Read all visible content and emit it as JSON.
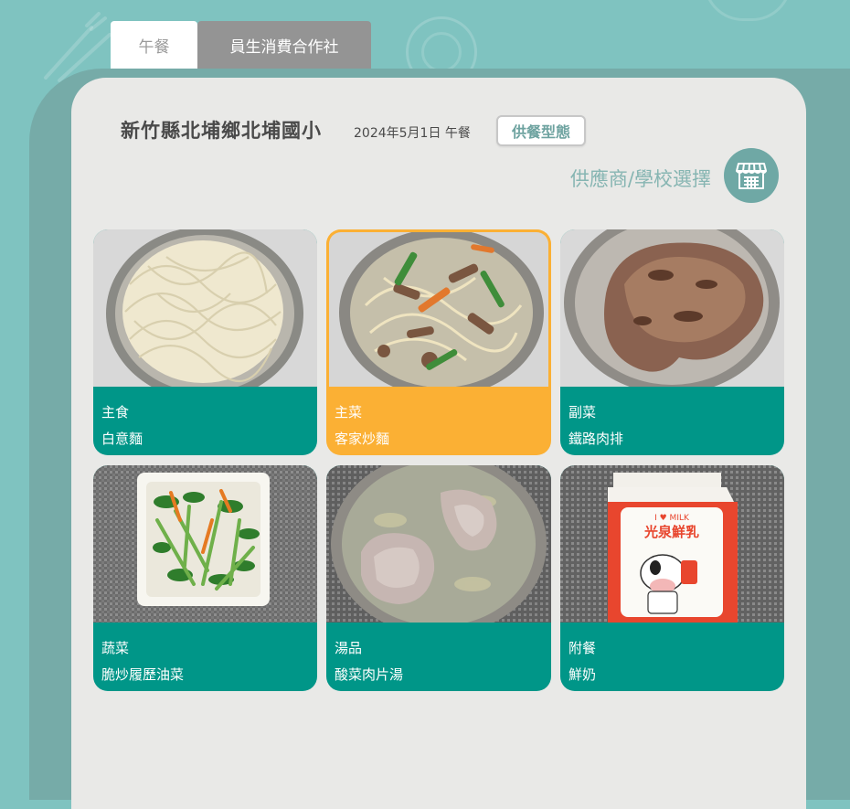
{
  "tabs": [
    {
      "label": "午餐",
      "active": true
    },
    {
      "label": "員生消費合作社",
      "active": false
    }
  ],
  "header": {
    "school_name": "新竹縣北埔鄉北埔國小",
    "meal_date": "2024年5月1日 午餐",
    "service_type_button": "供餐型態",
    "supplier_label": "供應商/學校選擇",
    "supplier_icon": "store-icon"
  },
  "colors": {
    "background": "#7fc3c0",
    "card": "#e9e9e7",
    "dish_caption": "#009688",
    "dish_highlight": "#fbb034",
    "accent_text": "#86b5b2"
  },
  "dishes": [
    {
      "category": "主食",
      "name": "白意麵",
      "highlight": false
    },
    {
      "category": "主菜",
      "name": "客家炒麵",
      "highlight": true
    },
    {
      "category": "副菜",
      "name": "鐵路肉排",
      "highlight": false
    },
    {
      "category": "蔬菜",
      "name": "脆炒履歷油菜",
      "highlight": false
    },
    {
      "category": "湯品",
      "name": "酸菜肉片湯",
      "highlight": false
    },
    {
      "category": "附餐",
      "name": "鮮奶",
      "highlight": false
    }
  ],
  "milk_carton": {
    "brand_line": "I ♥ MILK",
    "brand": "光泉鮮乳"
  }
}
